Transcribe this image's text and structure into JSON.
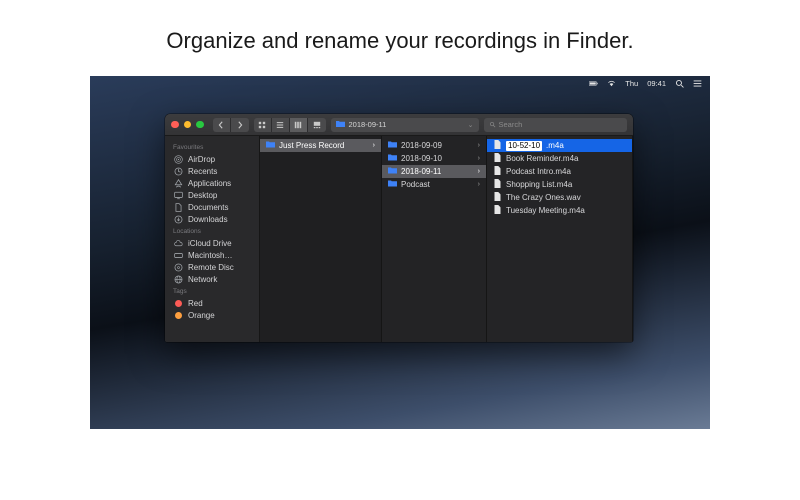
{
  "caption": "Organize and rename your recordings in Finder.",
  "menubar": {
    "day": "Thu",
    "time": "09:41"
  },
  "pathbar": {
    "folder": "2018-09-11"
  },
  "search": {
    "placeholder": "Search"
  },
  "sidebar": {
    "sections": [
      {
        "label": "Favourites",
        "items": [
          {
            "name": "AirDrop",
            "icon": "airdrop"
          },
          {
            "name": "Recents",
            "icon": "clock"
          },
          {
            "name": "Applications",
            "icon": "apps"
          },
          {
            "name": "Desktop",
            "icon": "desktop"
          },
          {
            "name": "Documents",
            "icon": "doc"
          },
          {
            "name": "Downloads",
            "icon": "download"
          }
        ]
      },
      {
        "label": "Locations",
        "items": [
          {
            "name": "iCloud Drive",
            "icon": "cloud"
          },
          {
            "name": "Macintosh…",
            "icon": "disk"
          },
          {
            "name": "Remote Disc",
            "icon": "disc"
          },
          {
            "name": "Network",
            "icon": "network"
          }
        ]
      },
      {
        "label": "Tags",
        "items": [
          {
            "name": "Red",
            "icon": "tag",
            "color": "#fc5b56"
          },
          {
            "name": "Orange",
            "icon": "tag",
            "color": "#fd9f3f"
          }
        ]
      }
    ]
  },
  "columns": {
    "col1": [
      {
        "name": "Just Press Record",
        "type": "folder",
        "selected": true
      }
    ],
    "col2": [
      {
        "name": "2018-09-09",
        "type": "folder"
      },
      {
        "name": "2018-09-10",
        "type": "folder"
      },
      {
        "name": "2018-09-11",
        "type": "folder",
        "selected": true
      },
      {
        "name": "Podcast",
        "type": "folder"
      }
    ],
    "col3": [
      {
        "name": "10-52-10",
        "ext": ".m4a",
        "type": "file",
        "editing": true
      },
      {
        "name": "Book Reminder.m4a",
        "type": "file"
      },
      {
        "name": "Podcast Intro.m4a",
        "type": "file"
      },
      {
        "name": "Shopping List.m4a",
        "type": "file"
      },
      {
        "name": "The Crazy Ones.wav",
        "type": "file"
      },
      {
        "name": "Tuesday Meeting.m4a",
        "type": "file"
      }
    ]
  }
}
